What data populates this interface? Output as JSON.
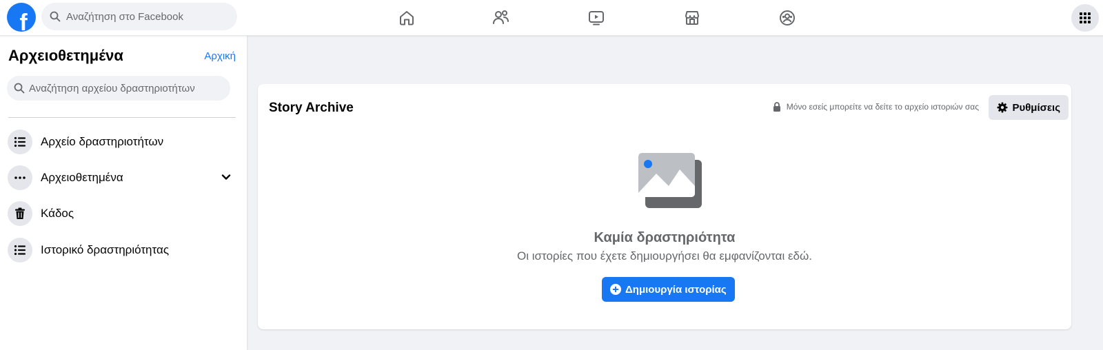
{
  "topbar": {
    "logo_letter": "f",
    "search_placeholder": "Αναζήτηση στο Facebook",
    "nav_icons": [
      "home-icon",
      "friends-icon",
      "watch-icon",
      "marketplace-icon",
      "groups-icon"
    ],
    "menu_icon": "grid-menu-icon"
  },
  "sidebar": {
    "title": "Αρχειοθετημένα",
    "home_link": "Αρχική",
    "search_placeholder": "Αναζήτηση αρχείου δραστηριοτήτων",
    "items": [
      {
        "label": "Αρχείο δραστηριοτήτων",
        "icon": "list-icon"
      },
      {
        "label": "Αρχειοθετημένα",
        "icon": "more-icon",
        "expandable": true
      },
      {
        "label": "Κάδος",
        "icon": "trash-icon"
      },
      {
        "label": "Ιστορικό δραστηριότητας",
        "icon": "list-icon"
      }
    ]
  },
  "main": {
    "title": "Story Archive",
    "privacy_note": "Μόνο εσείς μπορείτε να δείτε το αρχείο ιστοριών σας",
    "settings_label": "Ρυθμίσεις",
    "empty_title": "Καμία δραστηριότητα",
    "empty_subtitle": "Οι ιστορίες που έχετε δημιουργήσει θα εμφανίζονται εδώ.",
    "create_label": "Δημιουργία ιστορίας"
  },
  "colors": {
    "brand": "#1877f2",
    "background": "#f0f2f5",
    "secondary_text": "#65676b",
    "button_gray": "#e4e6eb"
  }
}
